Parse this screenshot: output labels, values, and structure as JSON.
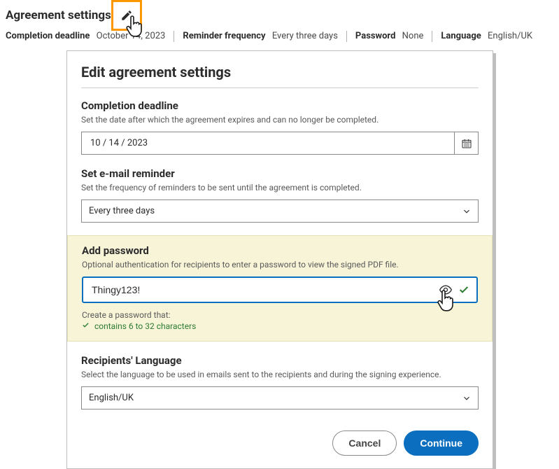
{
  "header": {
    "title": "Agreement settings",
    "summary": {
      "completion_deadline_label": "Completion deadline",
      "completion_deadline_value": "October 14, 2023",
      "reminder_label": "Reminder frequency",
      "reminder_value": "Every three days",
      "password_label": "Password",
      "password_value": "None",
      "language_label": "Language",
      "language_value": "English/UK"
    }
  },
  "modal": {
    "title": "Edit agreement settings",
    "completion": {
      "title": "Completion deadline",
      "desc": "Set the date after which the agreement expires and can no longer be completed.",
      "date": "10 / 14 / 2023"
    },
    "reminder": {
      "title": "Set e-mail reminder",
      "desc": "Set the frequency of reminders to be sent until the agreement is completed.",
      "value": "Every three days"
    },
    "password": {
      "title": "Add password",
      "desc": "Optional authentication for recipients to enter a password to view the signed PDF file.",
      "value": "Thingy123!",
      "rules_title": "Create a password that:",
      "rule_chars": "contains 6 to 32 characters"
    },
    "language": {
      "title": "Recipients' Language",
      "desc": "Select the language to be used in emails sent to the recipients and during the signing experience.",
      "value": "English/UK"
    },
    "buttons": {
      "cancel": "Cancel",
      "continue": "Continue"
    }
  }
}
